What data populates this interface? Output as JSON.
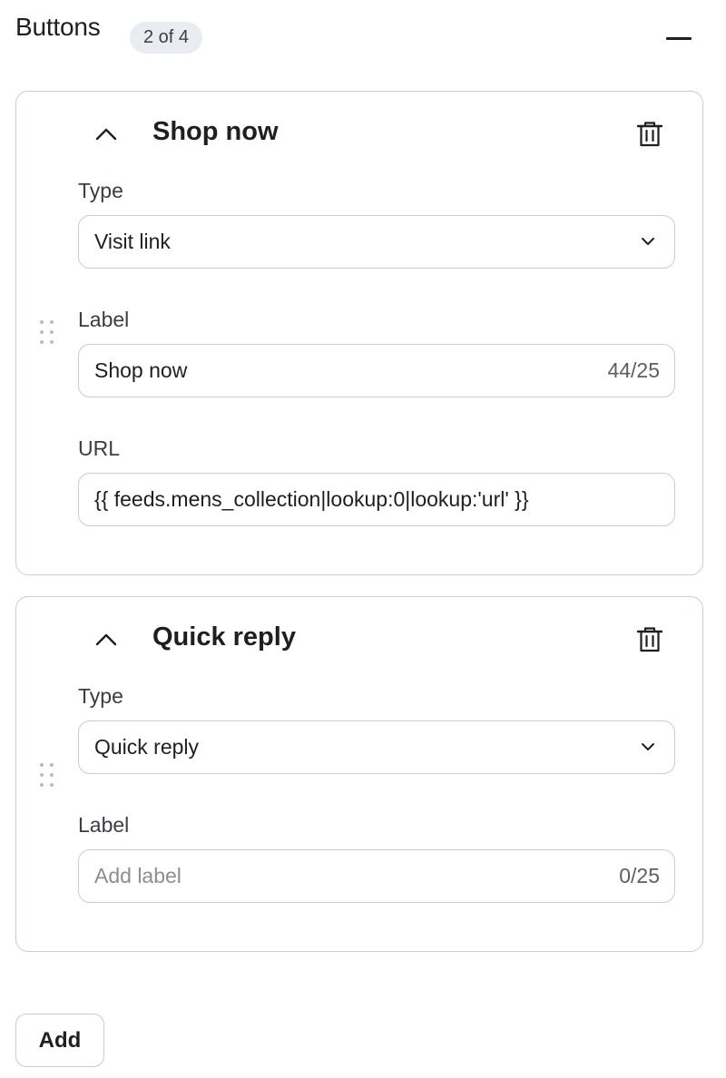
{
  "header": {
    "title": "Buttons",
    "count_badge": "2 of 4"
  },
  "buttons": [
    {
      "title": "Shop now",
      "type_label": "Type",
      "type_value": "Visit link",
      "label_label": "Label",
      "label_value": "Shop now",
      "label_placeholder": "",
      "label_counter": "44/25",
      "url_label": "URL",
      "url_value": "{{ feeds.mens_collection|lookup:0|lookup:'url' }}"
    },
    {
      "title": "Quick reply",
      "type_label": "Type",
      "type_value": "Quick reply",
      "label_label": "Label",
      "label_value": "",
      "label_placeholder": "Add label",
      "label_counter": "0/25"
    }
  ],
  "footer": {
    "add_label": "Add"
  },
  "icons": {
    "collapse": "minus-icon",
    "expand_state": "chevron-up-icon",
    "delete": "trash-icon",
    "select_arrow": "chevron-down-icon",
    "reorder": "drag-handle-icon"
  }
}
